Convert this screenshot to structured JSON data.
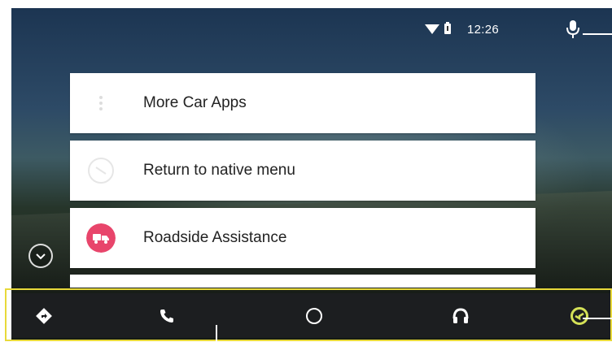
{
  "status_bar": {
    "time": "12:26",
    "icons": [
      "wifi-icon",
      "battery-icon"
    ]
  },
  "voice": {
    "icon": "microphone-icon"
  },
  "menu": {
    "items": [
      {
        "label": "More Car Apps",
        "icon": "apps-icon"
      },
      {
        "label": "Return to native menu",
        "icon": "exit-icon"
      },
      {
        "label": "Roadside Assistance",
        "icon": "roadside-assistance-icon",
        "icon_color": "#e8456b"
      }
    ]
  },
  "expand": {
    "icon": "chevron-down-icon"
  },
  "nav_bar": {
    "highlight_color": "#e8d93a",
    "accent_color": "#d4e157",
    "items": [
      {
        "icon": "navigation-icon"
      },
      {
        "icon": "phone-icon"
      },
      {
        "icon": "home-icon"
      },
      {
        "icon": "headphones-icon"
      },
      {
        "icon": "car-app-icon",
        "active": true
      }
    ]
  }
}
